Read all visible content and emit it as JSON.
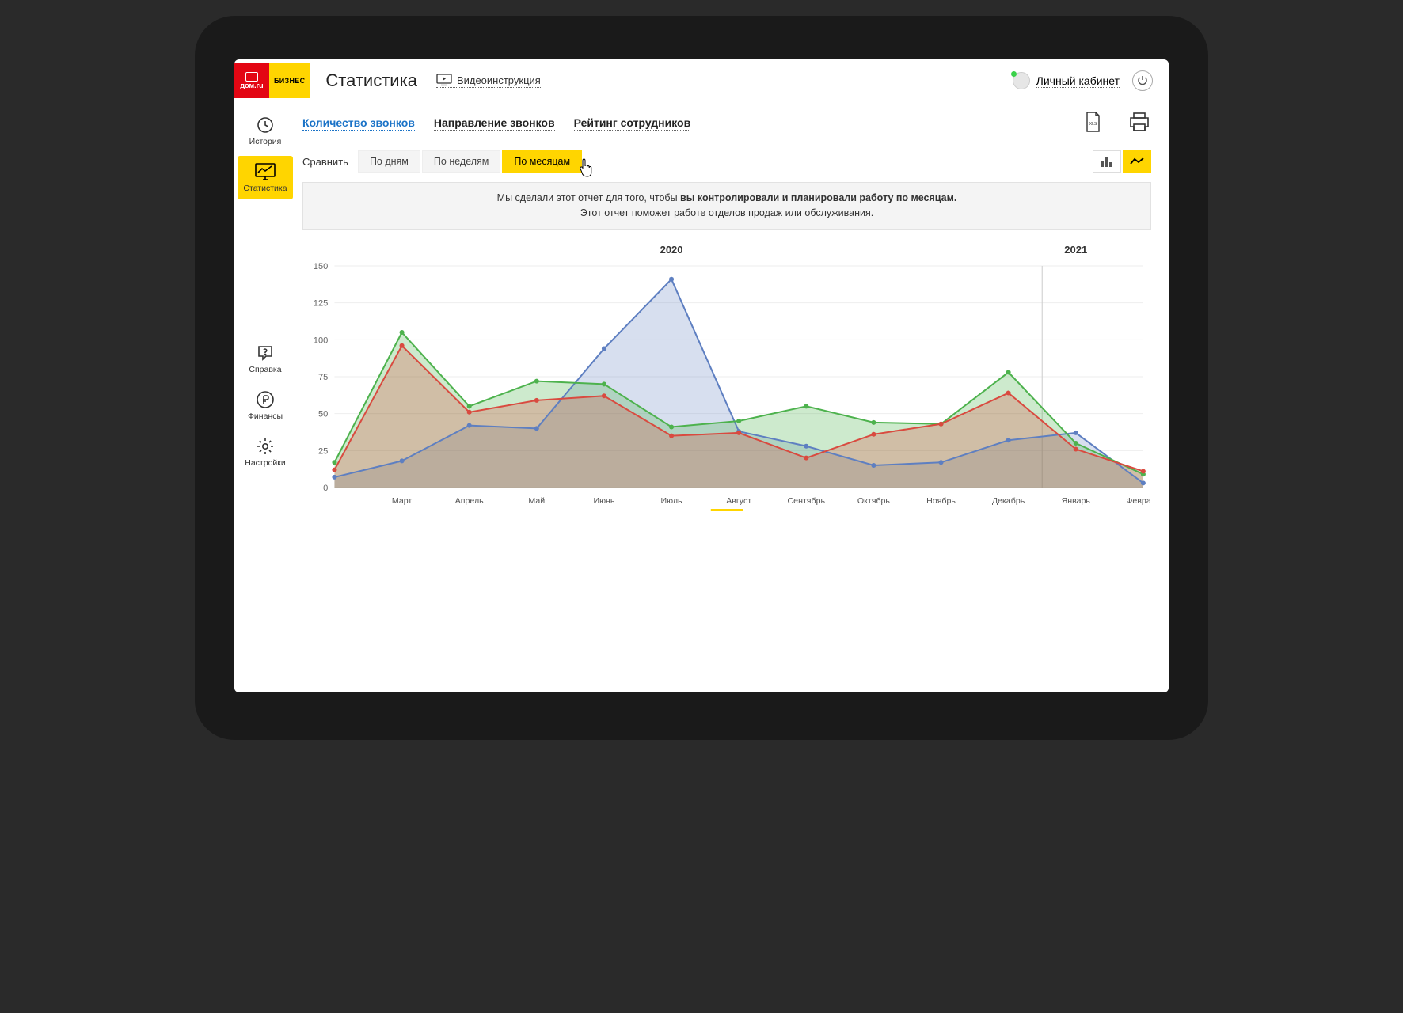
{
  "header": {
    "logo_text": "дом.ru",
    "logo_sub": "БИЗНЕС",
    "title": "Статистика",
    "video_link": "Видеоинструкция",
    "account": "Личный кабинет"
  },
  "sidebar": {
    "items": [
      {
        "label": "История"
      },
      {
        "label": "Статистика"
      },
      {
        "label": "Справка"
      },
      {
        "label": "Финансы"
      },
      {
        "label": "Настройки"
      }
    ]
  },
  "main_tabs": [
    {
      "label": "Количество звонков",
      "active": true
    },
    {
      "label": "Направление звонков"
    },
    {
      "label": "Рейтинг сотрудников"
    }
  ],
  "compare": {
    "label": "Сравнить",
    "options": [
      {
        "label": "По дням"
      },
      {
        "label": "По неделям"
      },
      {
        "label": "По месяцам",
        "active": true
      }
    ]
  },
  "info": {
    "line1_pre": "Мы сделали этот отчет для того, чтобы ",
    "line1_bold": "вы контролировали и планировали работу по месяцам.",
    "line2": "Этот отчет поможет работе отделов продаж или обслуживания."
  },
  "chart_data": {
    "type": "area",
    "title": "",
    "xlabel": "",
    "ylabel": "",
    "ylim": [
      0,
      150
    ],
    "yticks": [
      0,
      25,
      50,
      75,
      100,
      125,
      150
    ],
    "year_markers": [
      {
        "label": "2020",
        "position": 5
      },
      {
        "label": "2021",
        "position": 11
      }
    ],
    "categories": [
      "",
      "Март",
      "Апрель",
      "Май",
      "Июнь",
      "Июль",
      "Август",
      "Сентябрь",
      "Октябрь",
      "Ноябрь",
      "Декабрь",
      "Январь",
      "Февраль"
    ],
    "series": [
      {
        "name": "blue",
        "color": "#5e7fc1",
        "fill": "rgba(94,127,193,0.25)",
        "values": [
          7,
          18,
          42,
          40,
          94,
          141,
          38,
          28,
          15,
          17,
          32,
          37,
          3
        ]
      },
      {
        "name": "green",
        "color": "#4db24d",
        "fill": "rgba(77,178,77,0.28)",
        "values": [
          17,
          105,
          55,
          72,
          70,
          41,
          45,
          55,
          44,
          43,
          78,
          30,
          9
        ]
      },
      {
        "name": "red",
        "color": "#d94a3f",
        "fill": "rgba(217,74,63,0.28)",
        "values": [
          12,
          96,
          51,
          59,
          62,
          35,
          37,
          20,
          36,
          43,
          64,
          26,
          11
        ]
      }
    ]
  },
  "xls_label": "XLS"
}
